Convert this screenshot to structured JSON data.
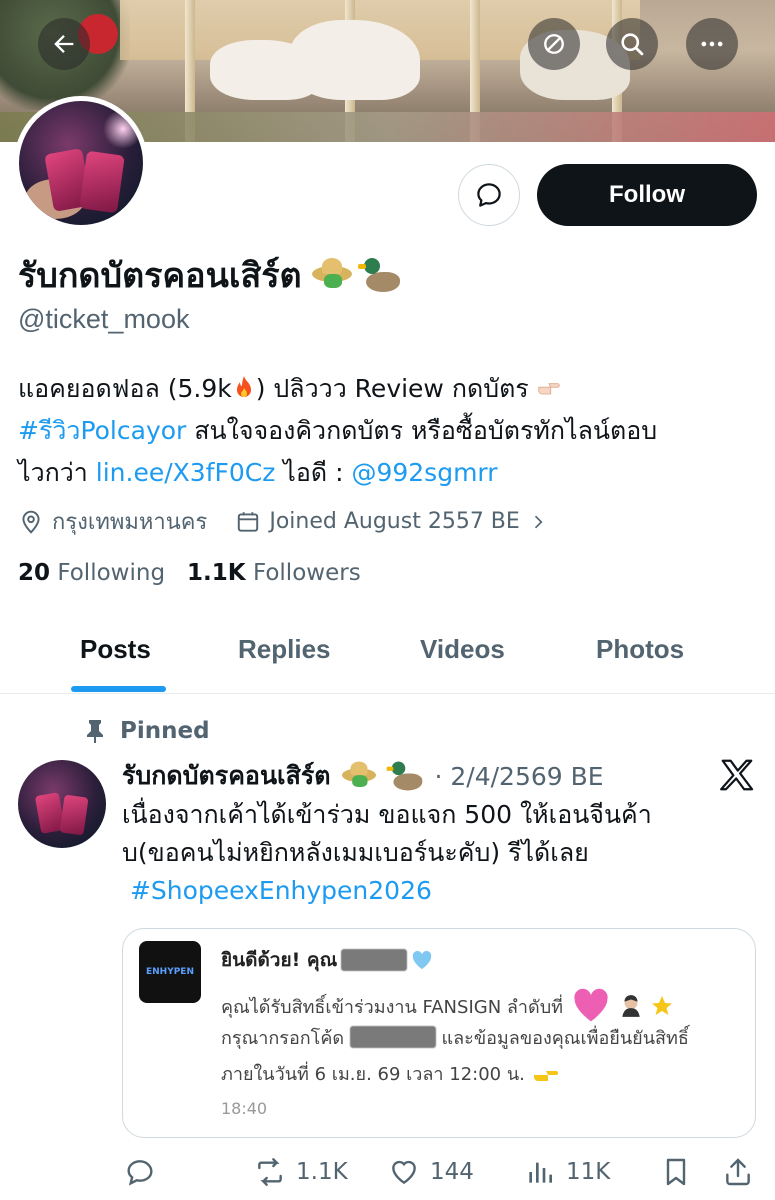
{
  "header": {
    "back_icon": "arrow-left-icon",
    "icons": [
      "block-icon",
      "search-icon",
      "more-icon"
    ]
  },
  "profile": {
    "display_name": "รับกดบัตรคอนเสิร์ต",
    "handle": "@ticket_mook",
    "follow_label": "Follow",
    "bio": {
      "line1_a": "แอคยอดฟอล (5.9k",
      "line1_b": ") ปลิววว Review กดบัตร ",
      "line2_hashtag": "#รีวิวPolcayor",
      "line2_b": " สนใจจองคิวกดบัตร หรือซื้อบัตรทักไลน์ตอบ",
      "line3_a": "ไวกว่า ",
      "line3_link": "lin.ee/X3fF0Cz",
      "line3_b": " ไอดี : ",
      "line3_id": "@992sgmrr"
    },
    "location": "กรุงเทพมหานคร",
    "joined": "Joined August 2557 BE",
    "following_count": "20",
    "following_label": "Following",
    "followers_count": "1.1K",
    "followers_label": "Followers"
  },
  "tabs": [
    {
      "label": "Posts",
      "active": true
    },
    {
      "label": "Replies",
      "active": false
    },
    {
      "label": "Videos",
      "active": false
    },
    {
      "label": "Photos",
      "active": false
    }
  ],
  "post": {
    "pinned_label": "Pinned",
    "name": "รับกดบัตรคอนเสิร์ต",
    "date": "· 2/4/2569 BE",
    "text_line1": "เนื่องจากเค้าได้เข้าร่วม ขอแจก 500 ให้เอนจีนค้า",
    "text_line2": "บ(ขอคนไม่หยิกหลังเมมเบอร์นะคับ) รีได้เลย",
    "hashtag": "#ShopeexEnhypen2026",
    "card": {
      "app_icon_text": "ENHYPEN",
      "title": "ยินดีด้วย! คุณ",
      "line1": "คุณได้รับสิทธิ์เข้าร่วมงาน FANSIGN ลำดับที่",
      "line2_a": "กรุณากรอกโค้ด",
      "line2_b": "และข้อมูลของคุณเพื่อยืนยันสิทธิ์",
      "line3": "ภายในวันที่ 6 เม.ย. 69 เวลา 12:00 น.",
      "time": "18:40"
    },
    "actions": {
      "reply_count": "",
      "retweet_count": "1.1K",
      "like_count": "144",
      "views_count": "11K"
    }
  },
  "colors": {
    "accent": "#1d9bf0",
    "text": "#0f1419",
    "muted": "#536471",
    "follow_bg": "#0f1419"
  }
}
